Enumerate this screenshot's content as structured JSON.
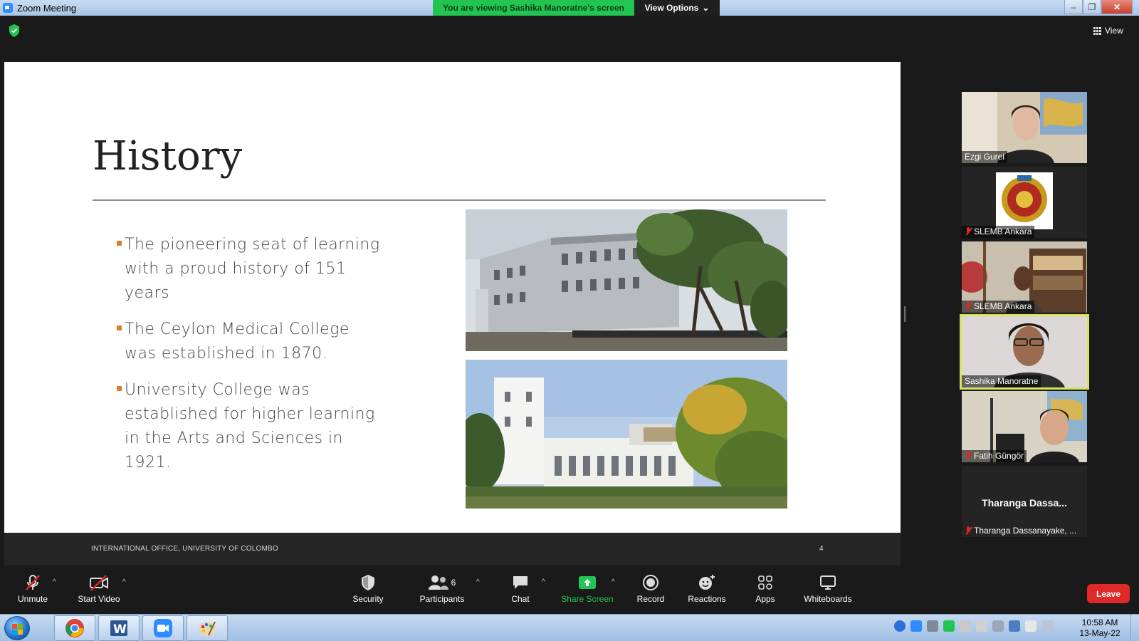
{
  "window": {
    "title": "Zoom Meeting",
    "banner": "You are viewing Sashika Manoratne's screen",
    "view_options": "View Options",
    "view": "View"
  },
  "slide": {
    "title": "History",
    "bullets": [
      "The pioneering seat of learning with a proud history of 151 years",
      "The Ceylon Medical College was established in 1870.",
      "University College was established for higher learning in the Arts and Sciences in 1921."
    ],
    "footer": "INTERNATIONAL OFFICE, UNIVERSITY OF COLOMBO",
    "page_number": "4",
    "accent": "#e07b2a"
  },
  "participants": [
    {
      "name": "Ezgi Gurel",
      "muted": false
    },
    {
      "name": "SLEMB Ankara",
      "muted": true
    },
    {
      "name": "SLEMB Ankara",
      "muted": true
    },
    {
      "name": "Sashika Manoratne",
      "muted": false,
      "speaking": true
    },
    {
      "name": "Fatih Güngör",
      "muted": true
    },
    {
      "name": "Tharanga Dassanayake, ...",
      "display": "Tharanga Dassa...",
      "muted": true
    }
  ],
  "controls": {
    "unmute": "Unmute",
    "start_video": "Start Video",
    "security": "Security",
    "participants": "Participants",
    "participant_count": "6",
    "chat": "Chat",
    "share_screen": "Share Screen",
    "record": "Record",
    "reactions": "Reactions",
    "apps": "Apps",
    "whiteboards": "Whiteboards",
    "leave": "Leave"
  },
  "taskbar": {
    "time": "10:58 AM",
    "date": "13-May-22"
  },
  "colors": {
    "share_green": "#23c552",
    "leave_red": "#e02828",
    "active_speaker": "#d7e35a"
  }
}
